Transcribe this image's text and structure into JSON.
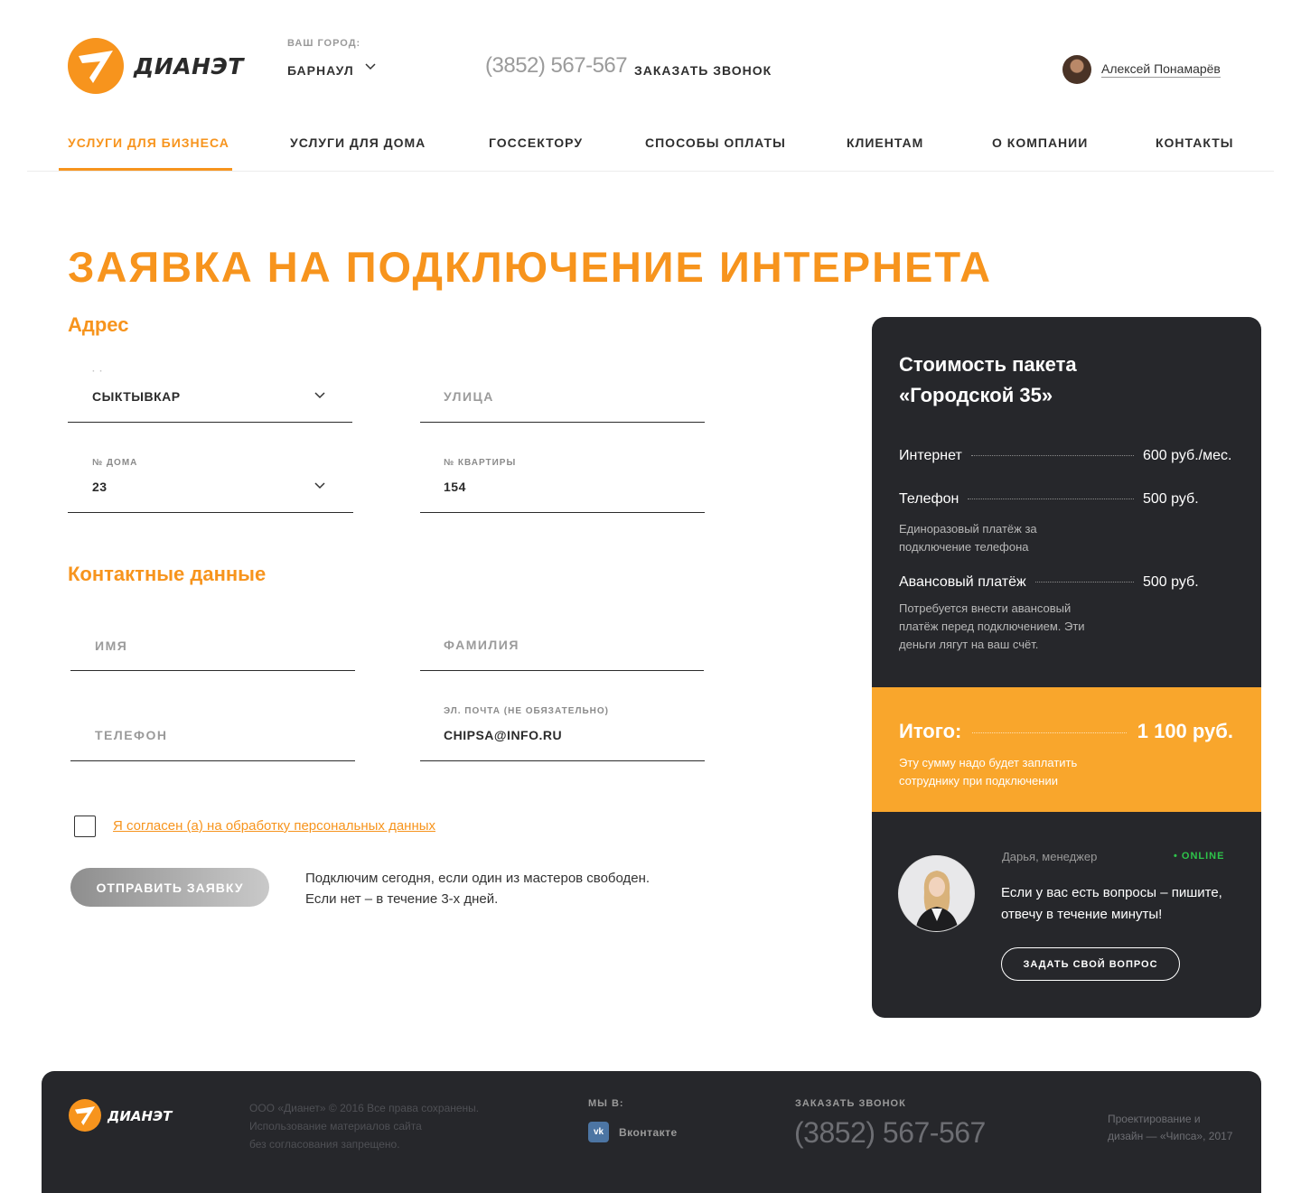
{
  "brand": {
    "name": "ДИАНЭТ",
    "accent": "#f7941d",
    "dark": "#26272b",
    "total_bg": "#f9a62c"
  },
  "header": {
    "city_label": "ВАШ ГОРОД:",
    "city": "БАРНАУЛ",
    "phone": "(3852) 567-567",
    "callback": "ЗАКАЗАТЬ ЗВОНОК",
    "user_name": "Алексей Понамарёв"
  },
  "nav": {
    "items": [
      {
        "label": "УСЛУГИ ДЛЯ БИЗНЕСА",
        "active": true
      },
      {
        "label": "УСЛУГИ ДЛЯ ДОМА"
      },
      {
        "label": "ГОССЕКТОРУ"
      },
      {
        "label": "СПОСОБЫ ОПЛАТЫ"
      },
      {
        "label": "КЛИЕНТАМ"
      },
      {
        "label": "О КОМПАНИИ"
      },
      {
        "label": "КОНТАКТЫ"
      }
    ]
  },
  "page": {
    "title": "ЗАЯВКА НА ПОДКЛЮЧЕНИЕ ИНТЕРНЕТА"
  },
  "address": {
    "heading": "Адрес",
    "city_label": "· ·",
    "city_value": "СЫКТЫВКАР",
    "street_placeholder": "УЛИЦА",
    "house_label": "№ ДОМА",
    "house_value": "23",
    "apt_label": "№ КВАРТИРЫ",
    "apt_value": "154"
  },
  "contacts": {
    "heading": "Контактные данные",
    "first_name_placeholder": "ИМЯ",
    "last_name_placeholder": "ФАМИЛИЯ",
    "phone_placeholder": "ТЕЛЕФОН",
    "email_label": "ЭЛ. ПОЧТА (НЕ ОБЯЗАТЕЛЬНО)",
    "email_value": "CHIPSA@INFO.RU"
  },
  "consent": {
    "label": "Я согласен (а) на обработку персональных данных",
    "checked": false
  },
  "submit": {
    "label": "ОТПРАВИТЬ ЗАЯВКУ",
    "note_line1": "Подключим сегодня, если один из мастеров свободен.",
    "note_line2": "Если нет – в течение 3-х дней."
  },
  "package": {
    "title_line1": "Стоимость пакета",
    "title_line2": "«Городской 35»",
    "rows": [
      {
        "name": "Интернет",
        "value": "600 руб./мес.",
        "note": ""
      },
      {
        "name": "Телефон",
        "value": "500 руб.",
        "note": "Единоразовый платёж за подключение телефона"
      },
      {
        "name": "Авансовый платёж",
        "value": "500 руб.",
        "note": "Потребуется внести авансовый платёж перед подключением. Эти деньги лягут на ваш счёт."
      }
    ],
    "total_label": "Итого:",
    "total_value": "1 100 руб.",
    "total_note": "Эту сумму надо будет заплатить сотруднику при подключении"
  },
  "manager": {
    "name": "Дарья, менеджер",
    "status": "• ONLINE",
    "message": "Если у вас есть вопросы – пишите, отвечу в течение минуты!",
    "button": "ЗАДАТЬ СВОЙ ВОПРОС"
  },
  "footer": {
    "copy_line1": "ООО «Дианет» © 2016 Все права сохранены.",
    "copy_line2": "Использование материалов сайта",
    "copy_line3": "без согласования запрещено.",
    "social_label": "МЫ В:",
    "vk_label": "Вконтакте",
    "callback_label": "ЗАКАЗАТЬ ЗВОНОК",
    "phone": "(3852) 567-567",
    "credit_line1": "Проектирование и",
    "credit_line2": "дизайн — «Чипса», 2017"
  }
}
